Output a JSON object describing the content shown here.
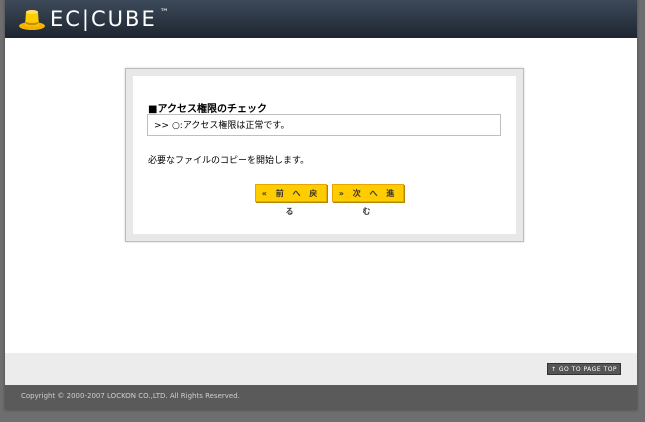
{
  "header": {
    "logo_text": "EC|CUBE",
    "logo_tm": "™"
  },
  "check": {
    "title": "■アクセス権限のチェック",
    "result": ">> ○:アクセス権限は正常です。",
    "message": "必要なファイルのコピーを開始します。"
  },
  "buttons": {
    "back_label": "« 前 へ 戻 る",
    "next_label": "» 次 へ 進 む"
  },
  "footer": {
    "page_top_label": "↑ GO TO PAGE TOP",
    "copyright": "Copyright © 2000-2007 LOCKON CO.,LTD. All Rights Reserved."
  },
  "colors": {
    "header": "#2b3441",
    "button": "#ffcc00",
    "footer": "#5a5a5a"
  }
}
